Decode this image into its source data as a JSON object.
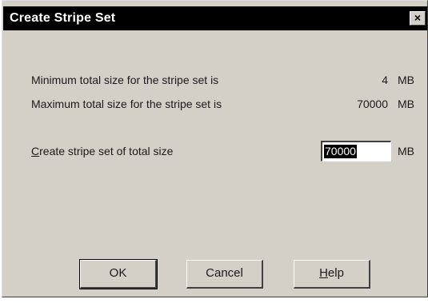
{
  "window": {
    "title": "Create Stripe Set",
    "close_glyph": "×"
  },
  "info": {
    "min_label": "Minimum total size for the stripe set is",
    "min_value": "4",
    "min_unit": "MB",
    "max_label": "Maximum total size for the stripe set is",
    "max_value": "70000",
    "max_unit": "MB"
  },
  "size_field": {
    "label_hotkey": "C",
    "label_rest": "reate stripe set of total size",
    "value": "70000",
    "unit": "MB"
  },
  "buttons": {
    "ok": "OK",
    "cancel": "Cancel",
    "help_hotkey": "H",
    "help_rest": "elp"
  },
  "colors": {
    "face": "#d4d0c8",
    "titlebar": "#000000",
    "selection": "#000000"
  }
}
